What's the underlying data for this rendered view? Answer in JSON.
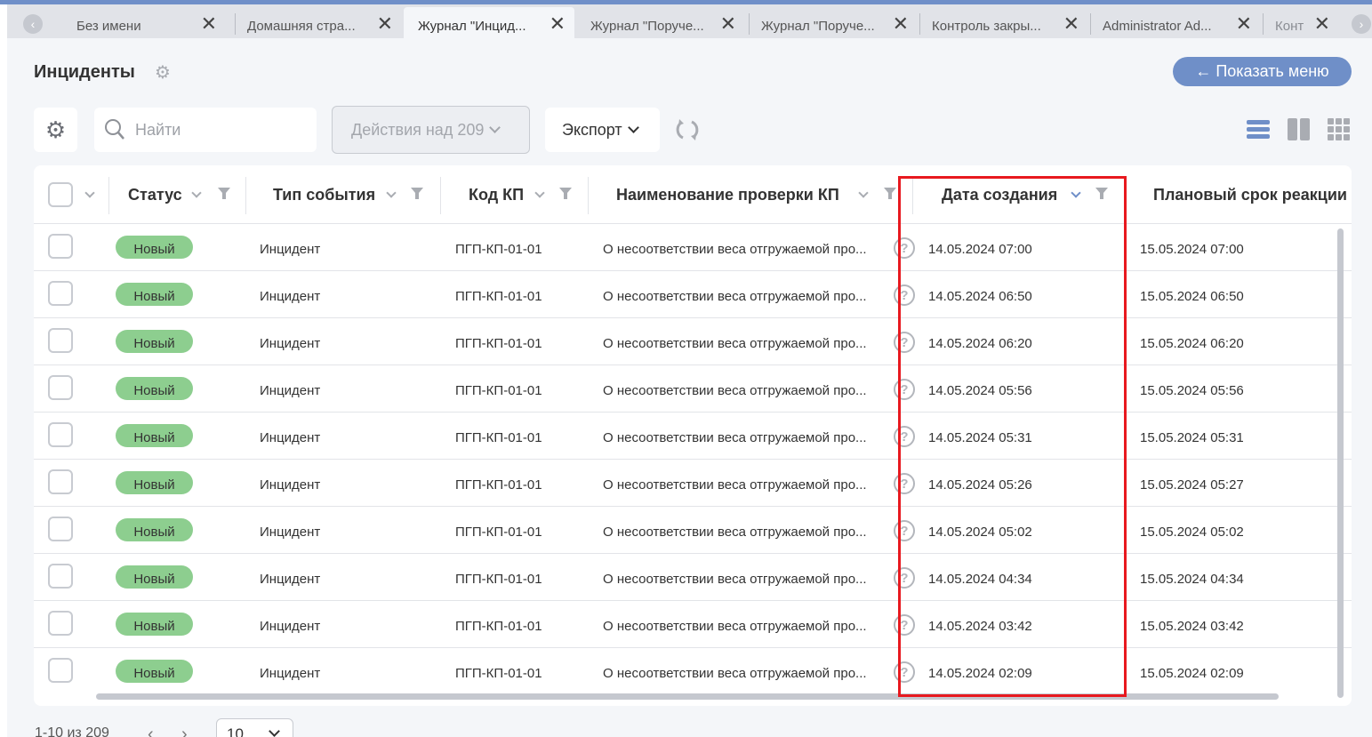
{
  "tabs": [
    {
      "label": "Без имени",
      "active": false
    },
    {
      "label": "Домашняя стра...",
      "active": false
    },
    {
      "label": "Журнал \"Инцид...",
      "active": true
    },
    {
      "label": "Журнал \"Поруче...",
      "active": false
    },
    {
      "label": "Журнал \"Поруче...",
      "active": false
    },
    {
      "label": "Контроль закры...",
      "active": false
    },
    {
      "label": "Administrator Ad...",
      "active": false
    },
    {
      "label": "Конт",
      "active": false
    }
  ],
  "tab_nav": {
    "prev_icon": "chevron-left-icon",
    "next_icon": "chevron-right-icon",
    "prev_glyph": "‹",
    "next_glyph": "›",
    "close_glyph": "✕"
  },
  "page": {
    "title": "Инциденты",
    "show_menu_label": "← Показать меню"
  },
  "toolbar": {
    "settings_icon": "gear-icon",
    "search_placeholder": "Найти",
    "search_value": "",
    "actions_label": "Действия над 209",
    "export_label": "Экспорт",
    "refresh_icon": "refresh-icon",
    "views": [
      "list-view-icon",
      "two-column-view-icon",
      "grid-view-icon"
    ]
  },
  "table": {
    "columns": [
      {
        "label": "Статус"
      },
      {
        "label": "Тип события"
      },
      {
        "label": "Код КП"
      },
      {
        "label": "Наименование проверки КП"
      },
      {
        "label": "Дата создания",
        "sorted": "desc"
      },
      {
        "label": "Плановый срок реакции"
      }
    ],
    "rows": [
      {
        "status": "Новый",
        "type": "Инцидент",
        "code": "ПГП-КП-01-01",
        "name": "О несоответствии веса отгружаемой про...",
        "created": "14.05.2024 07:00",
        "deadline": "15.05.2024 07:00"
      },
      {
        "status": "Новый",
        "type": "Инцидент",
        "code": "ПГП-КП-01-01",
        "name": "О несоответствии веса отгружаемой про...",
        "created": "14.05.2024 06:50",
        "deadline": "15.05.2024 06:50"
      },
      {
        "status": "Новый",
        "type": "Инцидент",
        "code": "ПГП-КП-01-01",
        "name": "О несоответствии веса отгружаемой про...",
        "created": "14.05.2024 06:20",
        "deadline": "15.05.2024 06:20"
      },
      {
        "status": "Новый",
        "type": "Инцидент",
        "code": "ПГП-КП-01-01",
        "name": "О несоответствии веса отгружаемой про...",
        "created": "14.05.2024 05:56",
        "deadline": "15.05.2024 05:56"
      },
      {
        "status": "Новый",
        "type": "Инцидент",
        "code": "ПГП-КП-01-01",
        "name": "О несоответствии веса отгружаемой про...",
        "created": "14.05.2024 05:31",
        "deadline": "15.05.2024 05:31"
      },
      {
        "status": "Новый",
        "type": "Инцидент",
        "code": "ПГП-КП-01-01",
        "name": "О несоответствии веса отгружаемой про...",
        "created": "14.05.2024 05:26",
        "deadline": "15.05.2024 05:27"
      },
      {
        "status": "Новый",
        "type": "Инцидент",
        "code": "ПГП-КП-01-01",
        "name": "О несоответствии веса отгружаемой про...",
        "created": "14.05.2024 05:02",
        "deadline": "15.05.2024 05:02"
      },
      {
        "status": "Новый",
        "type": "Инцидент",
        "code": "ПГП-КП-01-01",
        "name": "О несоответствии веса отгружаемой про...",
        "created": "14.05.2024 04:34",
        "deadline": "15.05.2024 04:34"
      },
      {
        "status": "Новый",
        "type": "Инцидент",
        "code": "ПГП-КП-01-01",
        "name": "О несоответствии веса отгружаемой про...",
        "created": "14.05.2024 03:42",
        "deadline": "15.05.2024 03:42"
      },
      {
        "status": "Новый",
        "type": "Инцидент",
        "code": "ПГП-КП-01-01",
        "name": "О несоответствии веса отгружаемой про...",
        "created": "14.05.2024 02:09",
        "deadline": "15.05.2024 02:09"
      }
    ],
    "help_glyph": "?"
  },
  "pagination": {
    "info": "1-10 из 209",
    "page_size": "10",
    "prev_glyph": "‹",
    "next_glyph": "›"
  },
  "colors": {
    "accent": "#6f8fc8",
    "status_new": "#8dce8f",
    "highlight": "#e8191f",
    "background": "#f4f6f9"
  }
}
